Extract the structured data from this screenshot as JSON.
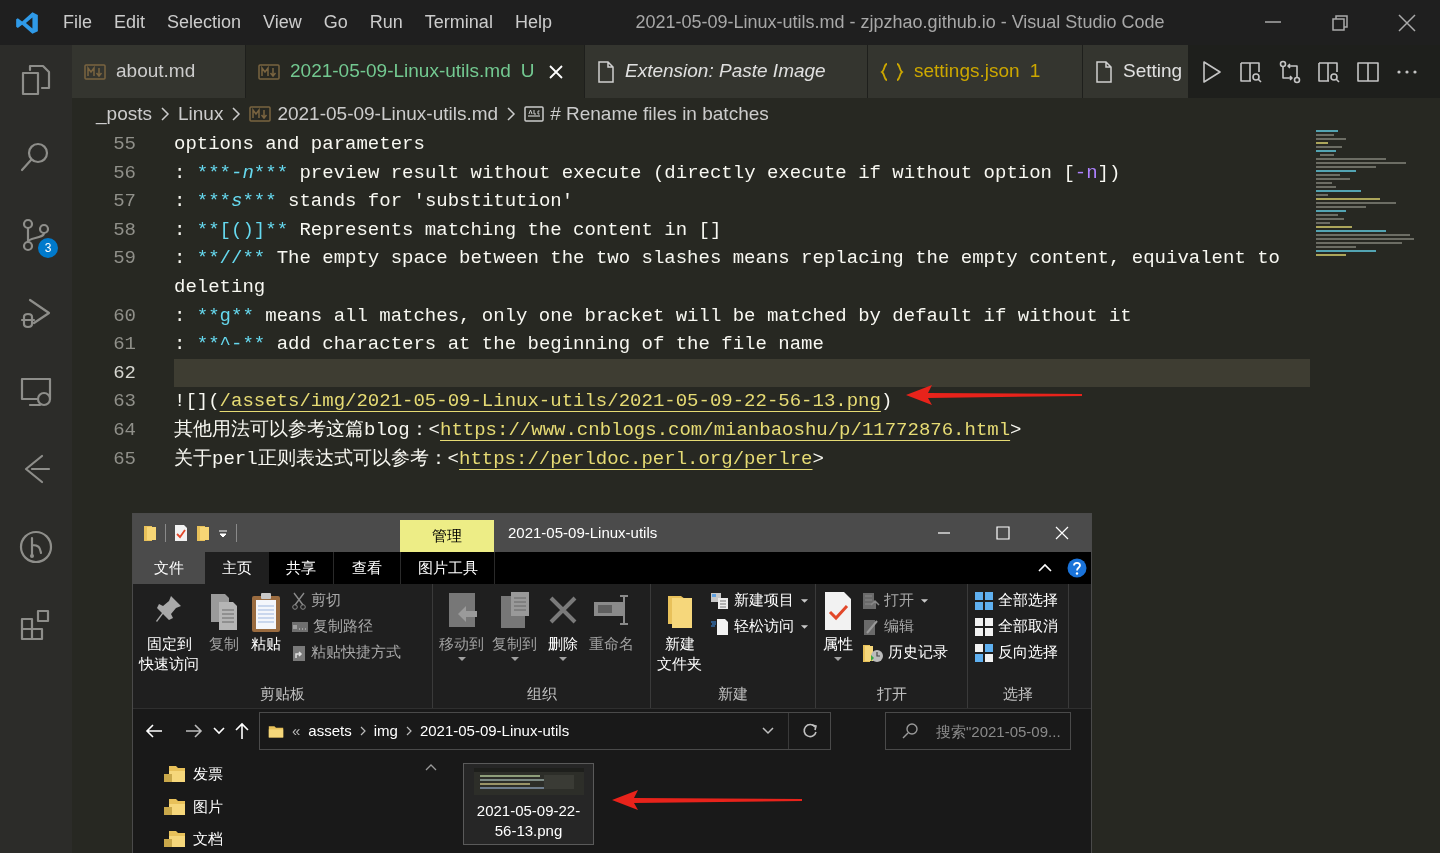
{
  "title_bar": {
    "menu": [
      "File",
      "Edit",
      "Selection",
      "View",
      "Go",
      "Run",
      "Terminal",
      "Help"
    ],
    "title": "2021-05-09-Linux-utils.md - zjpzhao.github.io - Visual Studio Code"
  },
  "activity_bar": {
    "source_control_badge": "3"
  },
  "tabs": [
    {
      "label": "about.md",
      "kind": "markdown",
      "selected": false,
      "preview": false,
      "color": "#cccccc"
    },
    {
      "label": "2021-05-09-Linux-utils.md",
      "kind": "markdown",
      "badge": "U",
      "selected": true,
      "preview": false,
      "color": "#73c991"
    },
    {
      "label": "Extension: Paste Image",
      "kind": "document",
      "selected": false,
      "preview": true,
      "color": "#e0e0e0"
    },
    {
      "label": "settings.json",
      "kind": "json",
      "badge": "1",
      "selected": false,
      "preview": false,
      "color": "#cca700"
    },
    {
      "label": "Setting",
      "kind": "document",
      "selected": false,
      "preview": false,
      "color": "#e0e0e0"
    }
  ],
  "breadcrumb": [
    {
      "label": "_posts",
      "kind": "folder"
    },
    {
      "label": "Linux",
      "kind": "folder"
    },
    {
      "label": "2021-05-09-Linux-utils.md",
      "kind": "markdown"
    },
    {
      "label": "# Rename files in batches",
      "kind": "symbol"
    }
  ],
  "editor": {
    "lines": [
      {
        "number": "55",
        "current": false,
        "segments": [
          {
            "text": "options and parameters",
            "kind": "text"
          }
        ]
      },
      {
        "number": "56",
        "current": false,
        "segments": [
          {
            "text": ": ",
            "kind": "text"
          },
          {
            "text": "***",
            "kind": "marker"
          },
          {
            "text": "-n",
            "kind": "emphasis"
          },
          {
            "text": "***",
            "kind": "marker"
          },
          {
            "text": " preview result without execute (directly execute if without option [",
            "kind": "text"
          },
          {
            "text": "-n",
            "kind": "constant"
          },
          {
            "text": "])",
            "kind": "text"
          }
        ]
      },
      {
        "number": "57",
        "current": false,
        "segments": [
          {
            "text": ": ",
            "kind": "text"
          },
          {
            "text": "***",
            "kind": "marker"
          },
          {
            "text": "s",
            "kind": "emphasis"
          },
          {
            "text": "***",
            "kind": "marker"
          },
          {
            "text": " stands for 'substitution'",
            "kind": "text"
          }
        ]
      },
      {
        "number": "58",
        "current": false,
        "segments": [
          {
            "text": ": ",
            "kind": "text"
          },
          {
            "text": "**[()]**",
            "kind": "marker"
          },
          {
            "text": " Represents matching the content in []",
            "kind": "text"
          }
        ]
      },
      {
        "number": "59",
        "current": false,
        "segments": [
          {
            "text": ": ",
            "kind": "text"
          },
          {
            "text": "**//**",
            "kind": "marker"
          },
          {
            "text": " The empty space between the two slashes means replacing the empty content, equivalent to deleting",
            "kind": "text"
          }
        ]
      },
      {
        "number": "60",
        "current": false,
        "segments": [
          {
            "text": ": ",
            "kind": "text"
          },
          {
            "text": "**g**",
            "kind": "marker"
          },
          {
            "text": " means all matches, only one bracket will be matched by default if without it",
            "kind": "text"
          }
        ]
      },
      {
        "number": "61",
        "current": false,
        "segments": [
          {
            "text": ": ",
            "kind": "text"
          },
          {
            "text": "**^-**",
            "kind": "marker"
          },
          {
            "text": " add characters at the beginning of the file name",
            "kind": "text"
          }
        ]
      },
      {
        "number": "62",
        "current": true
      },
      {
        "number": "63",
        "current": false,
        "segments": [
          {
            "text": "![](",
            "kind": "text"
          },
          {
            "text": "/assets/img/2021-05-09-Linux-utils/2021-05-09-22-56-13.png",
            "kind": "link"
          },
          {
            "text": ")",
            "kind": "text"
          }
        ]
      },
      {
        "number": "64",
        "current": false,
        "segments": [
          {
            "text": "其他用法可以参考这篇blog：<",
            "kind": "text"
          },
          {
            "text": "https://www.cnblogs.com/mianbaoshu/p/11772876.html",
            "kind": "link"
          },
          {
            "text": ">",
            "kind": "text"
          }
        ]
      },
      {
        "number": "65",
        "current": false,
        "segments": [
          {
            "text": "关于perl正则表达式可以参考：<",
            "kind": "text"
          },
          {
            "text": "https://perldoc.perl.org/perlre",
            "kind": "link"
          },
          {
            "text": ">",
            "kind": "text"
          }
        ]
      }
    ]
  },
  "file_explorer": {
    "context_tab": "管理",
    "title": "2021-05-09-Linux-utils",
    "ribbon_tabs": [
      {
        "label": "文件",
        "kind": "file",
        "selected": false
      },
      {
        "label": "主页",
        "kind": "tab",
        "selected": true
      },
      {
        "label": "共享",
        "kind": "tab",
        "selected": false
      },
      {
        "label": "查看",
        "kind": "tab",
        "selected": false
      },
      {
        "label": "图片工具",
        "kind": "tab",
        "selected": false
      }
    ],
    "groups": [
      {
        "label": "剪贴板",
        "items": [
          {
            "kind": "large",
            "label": [
              "固定到",
              "快速访问"
            ],
            "disabled": false,
            "dropdown": false
          },
          {
            "kind": "large",
            "label": "复制",
            "disabled": true,
            "dropdown": false
          },
          {
            "kind": "large",
            "label": "粘贴",
            "disabled": false,
            "dropdown": false
          },
          {
            "kind": "stack",
            "items": [
              {
                "label": "剪切",
                "disabled": true,
                "dropdown": false
              },
              {
                "label": "复制路径",
                "disabled": true,
                "dropdown": false
              },
              {
                "label": "粘贴快捷方式",
                "disabled": true,
                "dropdown": false
              }
            ]
          }
        ]
      },
      {
        "label": "组织",
        "items": [
          {
            "kind": "large",
            "label": "移动到",
            "disabled": true,
            "dropdown": true
          },
          {
            "kind": "large",
            "label": "复制到",
            "disabled": true,
            "dropdown": true
          },
          {
            "kind": "large",
            "label": "删除",
            "disabled": false,
            "dropdown": true
          },
          {
            "kind": "large",
            "label": "重命名",
            "disabled": true,
            "dropdown": false
          }
        ]
      },
      {
        "label": "新建",
        "items": [
          {
            "kind": "large",
            "label": [
              "新建",
              "文件夹"
            ],
            "disabled": false,
            "dropdown": false
          },
          {
            "kind": "stack",
            "items": [
              {
                "label": "新建项目",
                "disabled": false,
                "dropdown": true
              },
              {
                "label": "轻松访问",
                "disabled": false,
                "dropdown": true
              }
            ]
          }
        ]
      },
      {
        "label": "打开",
        "items": [
          {
            "kind": "large",
            "label": "属性",
            "disabled": false,
            "dropdown": true
          },
          {
            "kind": "stack",
            "items": [
              {
                "label": "打开",
                "disabled": true,
                "dropdown": true
              },
              {
                "label": "编辑",
                "disabled": true,
                "dropdown": false
              },
              {
                "label": "历史记录",
                "disabled": false,
                "dropdown": false
              }
            ]
          }
        ]
      },
      {
        "label": "选择",
        "items": [
          {
            "kind": "stack",
            "items": [
              {
                "label": "全部选择",
                "disabled": false,
                "dropdown": false
              },
              {
                "label": "全部取消",
                "disabled": false,
                "dropdown": false
              },
              {
                "label": "反向选择",
                "disabled": false,
                "dropdown": false
              }
            ]
          }
        ]
      }
    ],
    "address": {
      "overflow": "«",
      "path": [
        "assets",
        "img",
        "2021-05-09-Linux-utils"
      ]
    },
    "search": {
      "placeholder": "搜索\"2021-05-09..."
    },
    "nav_items": [
      "发票",
      "图片",
      "文档"
    ],
    "files": [
      {
        "name": "2021-05-09-22-56-13.png",
        "selected": true
      }
    ]
  }
}
